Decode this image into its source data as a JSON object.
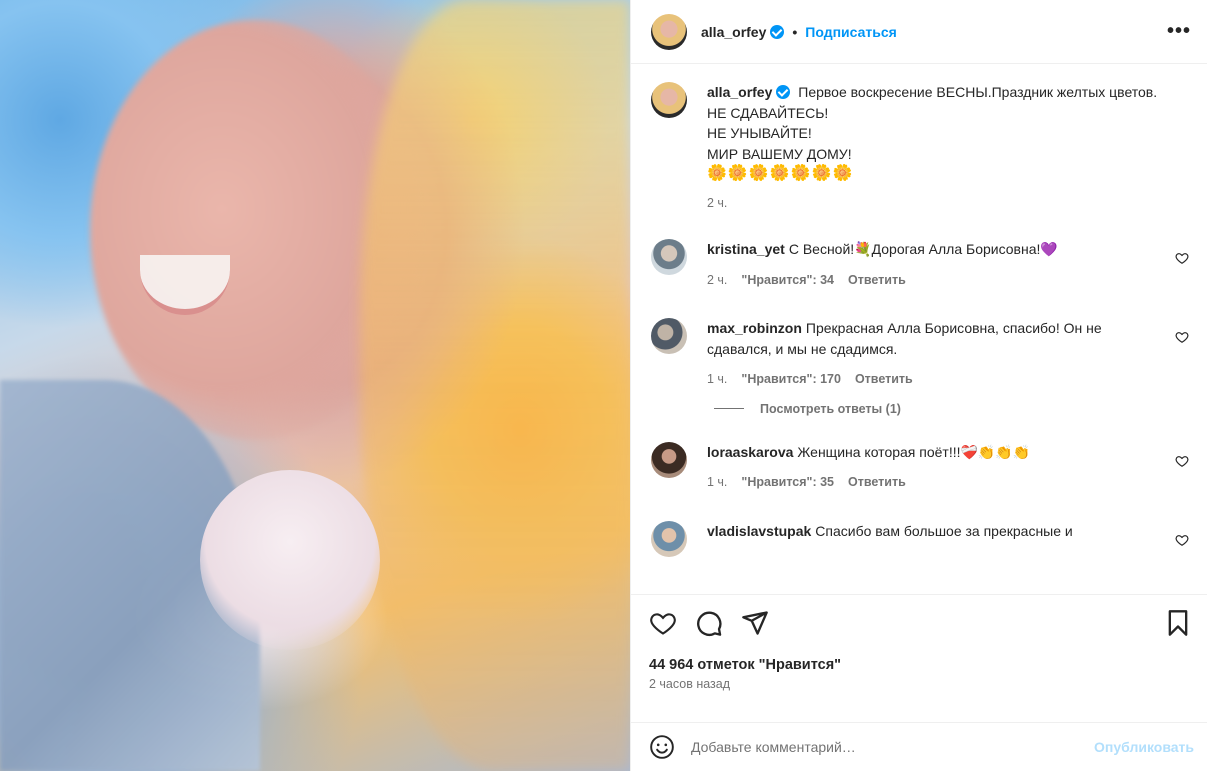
{
  "post": {
    "username": "alla_orfey",
    "follow_label": "Подписаться",
    "more_label": "•••"
  },
  "caption": {
    "username": "alla_orfey",
    "lines": [
      "Первое воскресение ВЕСНЫ.Праздник желтых цветов.",
      "НЕ СДАВАЙТЕСЬ!",
      "НЕ УНЫВАЙТЕ!",
      "МИР ВАШЕМУ ДОМУ!",
      "🌼🌼🌼🌼🌼🌼🌼"
    ],
    "time": "2 ч."
  },
  "comments": [
    {
      "username": "kristina_yet",
      "text": "С Весной!💐Дорогая Алла Борисовна!💜",
      "time": "2 ч.",
      "likes": "\"Нравится\": 34",
      "reply_label": "Ответить"
    },
    {
      "username": "max_robinzon",
      "text": "Прекрасная Алла Борисовна, спасибо! Он не сдавался, и мы не сдадимся.",
      "time": "1 ч.",
      "likes": "\"Нравится\": 170",
      "reply_label": "Ответить"
    },
    {
      "username": "loraaskarova",
      "text": "Женщина которая поёт!!!❤️‍🩹👏👏👏",
      "time": "1 ч.",
      "likes": "\"Нравится\": 35",
      "reply_label": "Ответить"
    },
    {
      "username": "vladislavstupak",
      "text": "Спасибо вам большое за прекрасные и"
    }
  ],
  "view_replies_label": "Посмотреть ответы (1)",
  "footer": {
    "likes_text": "44 964 отметок \"Нравится\"",
    "time_text": "2 часов назад"
  },
  "composer": {
    "placeholder": "Добавьте комментарий…",
    "post_label": "Опубликовать"
  },
  "colors": {
    "accent": "#0095f6",
    "post_disabled": "#b2dffc",
    "muted": "#737373"
  },
  "icons": [
    "heart-icon",
    "comment-icon",
    "share-icon",
    "bookmark-icon",
    "emoji-icon",
    "verified-icon"
  ]
}
